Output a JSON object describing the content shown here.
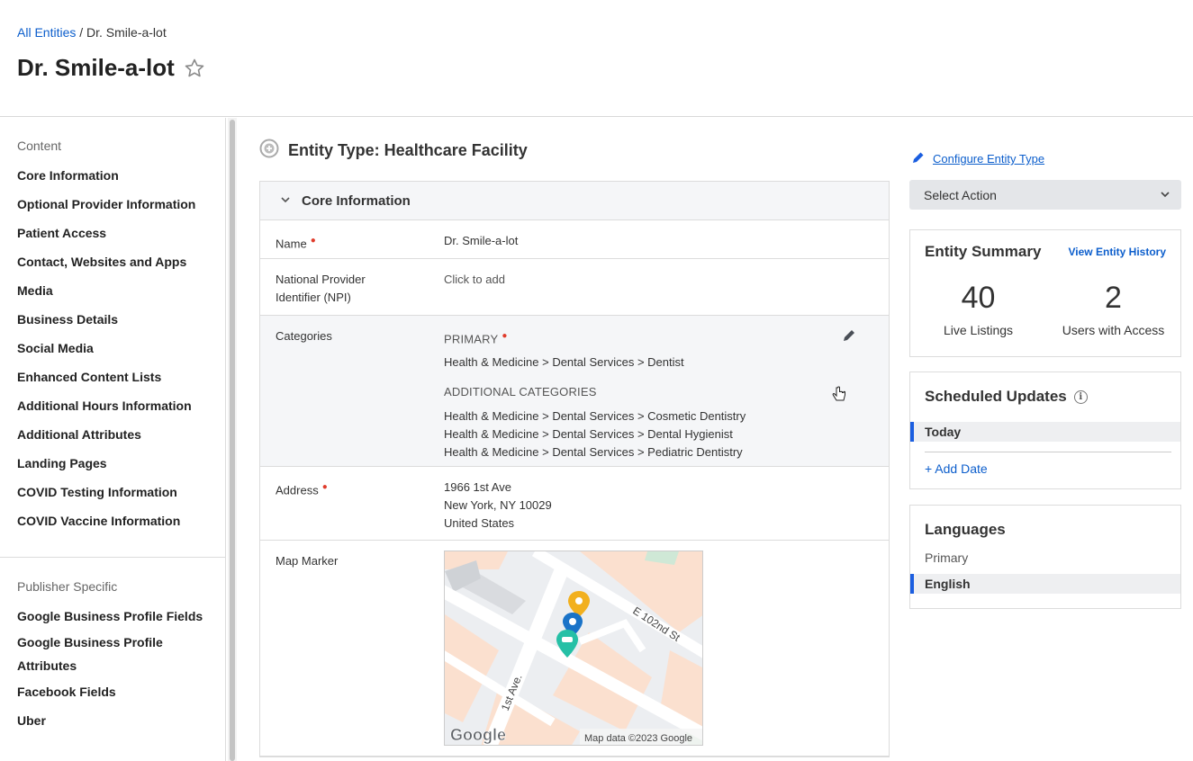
{
  "breadcrumb": {
    "root": "All Entities",
    "separator": " / ",
    "current": "Dr. Smile-a-lot"
  },
  "page": {
    "title": "Dr. Smile-a-lot"
  },
  "sidebar": {
    "content_title": "Content",
    "content_items": [
      "Core Information",
      "Optional Provider Information",
      "Patient Access",
      "Contact, Websites and Apps",
      "Media",
      "Business Details",
      "Social Media",
      "Enhanced Content Lists",
      "Additional Hours Information",
      "Additional Attributes",
      "Landing Pages",
      "COVID Testing Information",
      "COVID Vaccine Information"
    ],
    "publisher_title": "Publisher Specific",
    "publisher_items": [
      "Google Business Profile Fields",
      "Google Business Profile Attributes",
      "Facebook Fields",
      "Uber"
    ]
  },
  "main": {
    "entity_type": "Entity Type: Healthcare Facility",
    "section_title": "Core Information",
    "fields": {
      "name_label": "Name",
      "name_value": "Dr. Smile-a-lot",
      "npi_label": "National Provider Identifier (NPI)",
      "npi_value": "Click to add",
      "categories_label": "Categories",
      "primary_heading": "PRIMARY",
      "primary_value": "Health & Medicine > Dental Services > Dentist",
      "additional_heading": "ADDITIONAL CATEGORIES",
      "additional_values": [
        "Health & Medicine > Dental Services > Cosmetic Dentistry",
        "Health & Medicine > Dental Services > Dental Hygienist",
        "Health & Medicine > Dental Services > Pediatric Dentistry"
      ],
      "address_label": "Address",
      "address_lines": [
        "1966 1st Ave",
        "New York, NY 10029",
        "United States"
      ],
      "map_label": "Map Marker"
    },
    "map": {
      "street_1": "E 102nd St",
      "street_2": "1st Ave.",
      "logo": "Google",
      "attribution": "Map data ©2023 Google"
    }
  },
  "right": {
    "configure_link": "Configure Entity Type",
    "select_action": "Select Action",
    "summary": {
      "title": "Entity Summary",
      "history_link": "View Entity History",
      "live_listings_count": "40",
      "live_listings_label": "Live Listings",
      "users_count": "2",
      "users_label": "Users with Access"
    },
    "scheduled": {
      "title": "Scheduled Updates",
      "today": "Today",
      "add_date": "+ Add Date"
    },
    "languages": {
      "title": "Languages",
      "primary_label": "Primary",
      "primary_value": "English"
    }
  },
  "colors": {
    "link": "#0c5ecc",
    "accent": "#1b5ee0",
    "required": "#e03c2c"
  }
}
